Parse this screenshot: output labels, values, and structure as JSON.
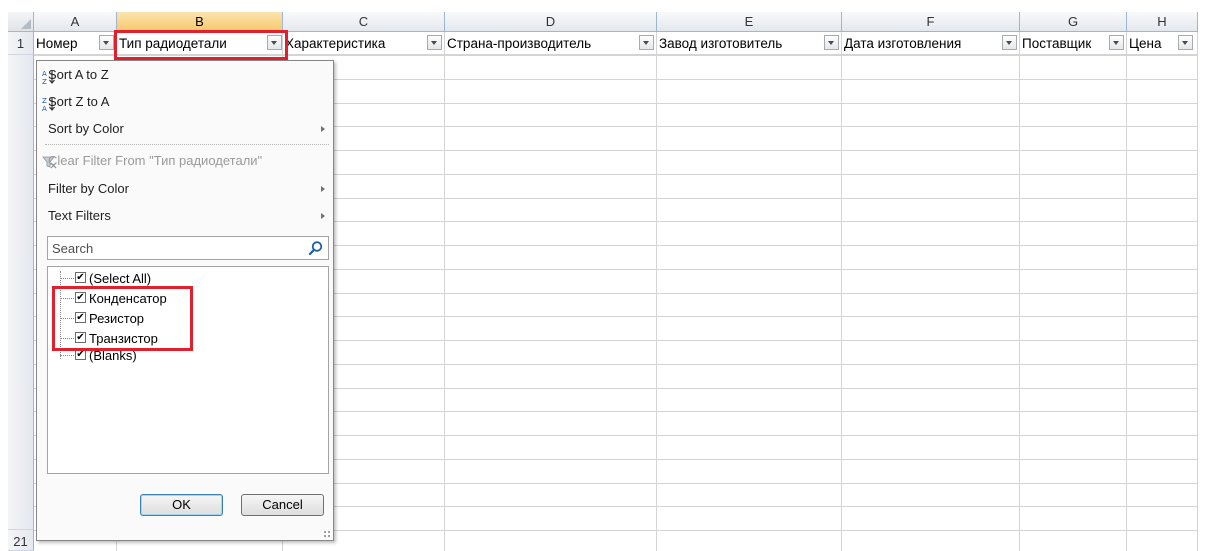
{
  "columns": [
    {
      "letter": "A",
      "header": "Номер"
    },
    {
      "letter": "B",
      "header": "Тип радиодетали"
    },
    {
      "letter": "C",
      "header": "Характеристика"
    },
    {
      "letter": "D",
      "header": "Страна-производитель"
    },
    {
      "letter": "E",
      "header": "Завод изготовитель"
    },
    {
      "letter": "F",
      "header": "Дата изготовления"
    },
    {
      "letter": "G",
      "header": "Поставщик"
    },
    {
      "letter": "H",
      "header": "Цена"
    }
  ],
  "rows": {
    "first": "1",
    "last": "21"
  },
  "filter_menu": {
    "sort_az": "Sort A to Z",
    "sort_za": "Sort Z to A",
    "sort_by_color": "Sort by Color",
    "clear_filter": "Clear Filter From \"Тип радиодетали\"",
    "filter_by_color": "Filter by Color",
    "text_filters": "Text Filters",
    "search_placeholder": "Search",
    "items": [
      {
        "label": "(Select All)",
        "checked": true
      },
      {
        "label": "Конденсатор",
        "checked": true
      },
      {
        "label": "Резистор",
        "checked": true
      },
      {
        "label": "Транзистор",
        "checked": true
      },
      {
        "label": "(Blanks)",
        "checked": true
      }
    ],
    "ok_label": "OK",
    "cancel_label": "Cancel"
  },
  "icons": {
    "sort_az": "sort-az-icon",
    "sort_za": "sort-za-icon",
    "clear_filter": "clear-filter-icon",
    "search": "magnifier-icon"
  },
  "colors": {
    "highlight": "#e0202c",
    "selected_column_header": "#f7c96b",
    "grid_line": "#d4d4d4",
    "header_border": "#9eb6ce"
  }
}
